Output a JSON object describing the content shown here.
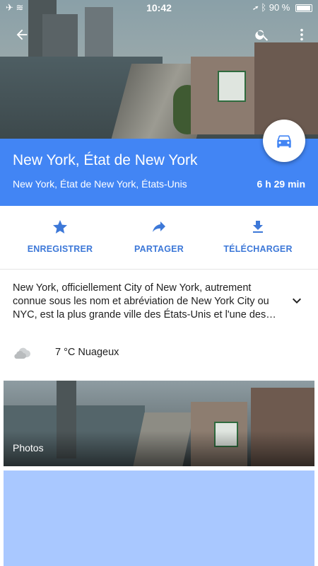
{
  "status_bar": {
    "time": "10:42",
    "battery": "90 %"
  },
  "place": {
    "title": "New York, État de New York",
    "subtitle": "New York, État de New York, États-Unis",
    "eta": "6 h 29 min"
  },
  "actions": [
    {
      "label": "ENREGISTRER",
      "icon": "star-icon"
    },
    {
      "label": "PARTAGER",
      "icon": "share-icon"
    },
    {
      "label": "TÉLÉCHARGER",
      "icon": "download-icon"
    }
  ],
  "description": {
    "text": "New York, officiellement City of New York, autrement connue sous les nom et abréviation de New York City ou NYC, est la plus grande ville des États-Unis et l'une des…"
  },
  "weather": {
    "text": "7 °C Nuageux",
    "icon": "cloud-icon"
  },
  "photos": {
    "label": "Photos"
  },
  "colors": {
    "accent": "#4285f4",
    "action_text": "#3d78d8",
    "placeholder_block": "#a9c8ff"
  }
}
